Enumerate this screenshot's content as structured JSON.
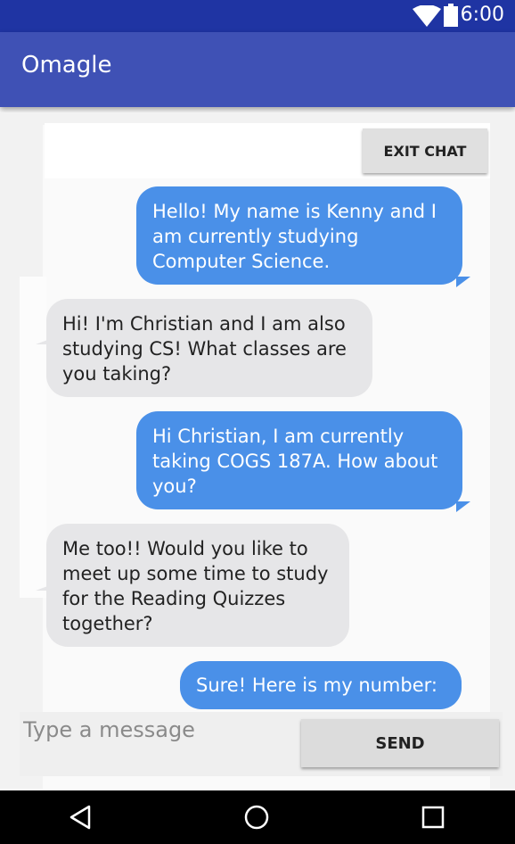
{
  "status_bar": {
    "time": "6:00",
    "wifi_icon": "wifi-icon",
    "battery_icon": "battery-icon"
  },
  "app_bar": {
    "title": "Omagle"
  },
  "chat": {
    "exit_label": "EXIT CHAT",
    "messages": [
      {
        "sender": "me",
        "lines": [
          "Hello! My name is Kenny and I",
          "am currently studying",
          "Computer Science."
        ]
      },
      {
        "sender": "them",
        "lines": [
          "Hi! I'm Christian and I am also",
          "studying CS! What classes are",
          "you taking?"
        ]
      },
      {
        "sender": "me",
        "lines": [
          "Hi Christian, I am currently",
          "taking COGS 187A. How about",
          "you?"
        ]
      },
      {
        "sender": "them",
        "lines": [
          "Me too!! Would you like to",
          "meet up some time to study",
          "for the Reading Quizzes",
          "together?"
        ]
      },
      {
        "sender": "me",
        "lines": [
          "Sure! Here is my number:"
        ]
      }
    ]
  },
  "composer": {
    "placeholder": "Type a message",
    "send_label": "SEND"
  },
  "nav": {
    "back_icon": "back-triangle-icon",
    "home_icon": "home-circle-icon",
    "recents_icon": "recents-square-icon"
  },
  "colors": {
    "status_bar": "#1f34a3",
    "app_bar": "#3f51b5",
    "my_bubble": "#4a90e8",
    "their_bubble": "#e6e6e8"
  }
}
